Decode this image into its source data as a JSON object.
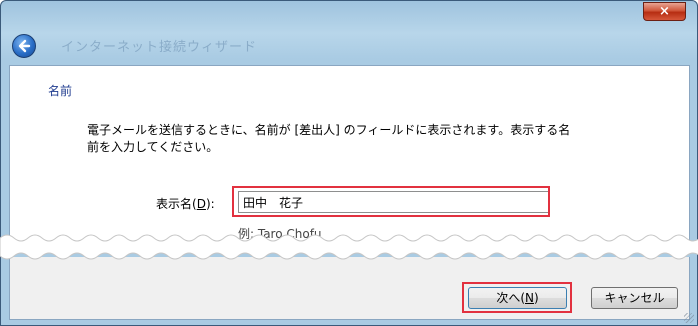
{
  "window": {
    "title": "インターネット接続ウィザード",
    "close_label": "×"
  },
  "content": {
    "heading": "名前",
    "description": "電子メールを送信するときに、名前が [差出人] のフィールドに表示されます。表示する名前を入力してください。",
    "display_name_label_prefix": "表示名(",
    "display_name_label_key": "D",
    "display_name_label_suffix": "):",
    "display_name_value": "田中　花子",
    "example_text": "例: Taro Chofu"
  },
  "footer": {
    "next_label_prefix": "次へ(",
    "next_label_key": "N",
    "next_label_suffix": ")",
    "cancel_label": "キャンセル"
  },
  "colors": {
    "highlight": "#e2313f",
    "heading": "#1f3b8f",
    "frame": "#a9cbe3"
  },
  "icons": [
    "back-arrow-icon",
    "close-icon",
    "resize-grip-icon"
  ]
}
